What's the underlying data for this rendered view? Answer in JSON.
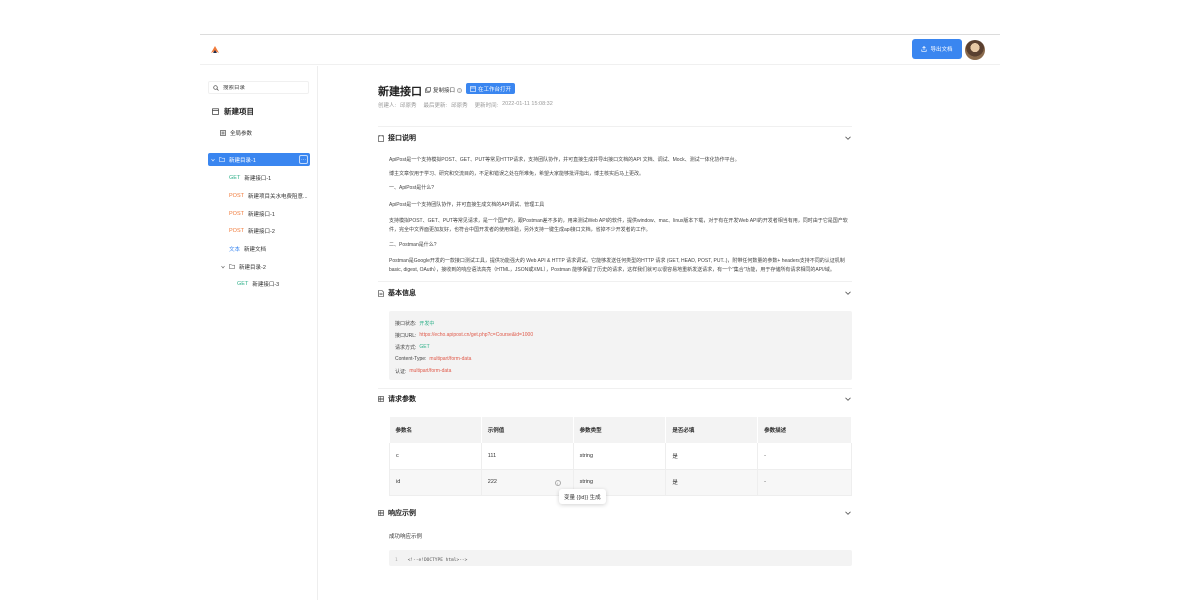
{
  "header": {
    "export_label": "导出文档"
  },
  "sidebar": {
    "search_placeholder": "搜索目录",
    "project_name": "新建项目",
    "global_params": "全局参数",
    "tree": [
      {
        "kind": "folder",
        "label": "新建目录-1",
        "active": true
      },
      {
        "method": "GET",
        "label": "新建接口-1"
      },
      {
        "method": "POST",
        "label": "新建项目关水电费阻意..."
      },
      {
        "method": "POST",
        "label": "新建接口-1"
      },
      {
        "method": "POST",
        "label": "新建接口-2"
      },
      {
        "method": "文本",
        "label": "新建文档"
      },
      {
        "kind": "folder",
        "label": "新建目录-2"
      },
      {
        "method": "GET",
        "label": "新建接口-3"
      }
    ]
  },
  "main": {
    "title": "新建接口",
    "copy_label": "复制接口",
    "open_label": "在工作台打开",
    "meta": {
      "creator_label": "创建人:",
      "creator": "邱原秀",
      "updater_label": "最后更新:",
      "updater": "邱原秀",
      "time_label": "更新时间:",
      "time": "2022-01-11 15:08:32"
    },
    "sections": {
      "desc": "接口说明",
      "basic": "基本信息",
      "params": "请求参数",
      "response": "响应示例"
    },
    "description": [
      "ApiPost是一个支持模拟POST、GET、PUT等常见HTTP请求，支持团队协作，并可直接生成并导出接口文档的API 文档、调试、Mock、测试一体化协作平台。",
      "博主文章仅用于学习、研究和交流目的，不足和错误之处在所难免，希望大家能够批评指出，博主核实后马上更改。",
      "一、ApiPost是什么?",
      "ApiPost是一个支持团队协作，并可直接生成文档的API调试、管理工具",
      "支持模拟POST、GET、PUT等常见请求，是一个国产的，跟Postman差不多的，用来测试Web API的软件，提供window、mac、linux版本下载，对于有在开发Web API的开发者相当有用，同时由于它是国产软件，完全中文界面更加友好，也符合中国开发者的使用体验，另外支持一键生成api接口文档，省掉不少开发者的工作。",
      "二、Postman是什么?",
      "Postman是Google开发的一款接口测试工具，提供功能强大的 Web API & HTTP 请求调试。它能够发送任何类型的HTTP 请求 (GET, HEAD, POST, PUT..)，附带任何数量的参数+ headers支持不同的认证机制basic, digest, OAuth），接收到的响应语法高亮（HTML，JSON或XML），Postman 能够保留了历史的请求，这样我们就可以很容易地重新发送请求，有一个“集合”功能，用于存储所有请求相同的API/域。"
    ],
    "basic": [
      {
        "label": "接口状态:",
        "value": "开发中",
        "color": "#2fb08a"
      },
      {
        "label": "接口URL:",
        "value": "https://echo.apipost.cn/get.php?c=Course&id=1000",
        "color": "#e05a4a"
      },
      {
        "label": "请求方式:",
        "value": "GET",
        "color": "#2fb08a"
      },
      {
        "label": "Content-Type:",
        "value": "multipart/form-data",
        "color": "#e05a4a"
      },
      {
        "label": "认证:",
        "value": "multipart/form-data",
        "color": "#e05a4a"
      }
    ],
    "params_table": {
      "headers": [
        "参数名",
        "示例值",
        "参数类型",
        "是否必填",
        "参数描述"
      ],
      "rows": [
        [
          "c",
          "111",
          "string",
          "是",
          "-"
        ],
        [
          "id",
          "222",
          "string",
          "是",
          "-"
        ]
      ]
    },
    "tooltip": "变量 {{id}} 生成",
    "response_label": "成功响应示例",
    "code_line_no": "1",
    "code_line": "<!--e!DOCTYPE html>-->"
  },
  "colors": {
    "accent": "#3a86f0",
    "get": "#2fb08a",
    "post": "#f07a3a",
    "danger": "#e05a4a"
  }
}
